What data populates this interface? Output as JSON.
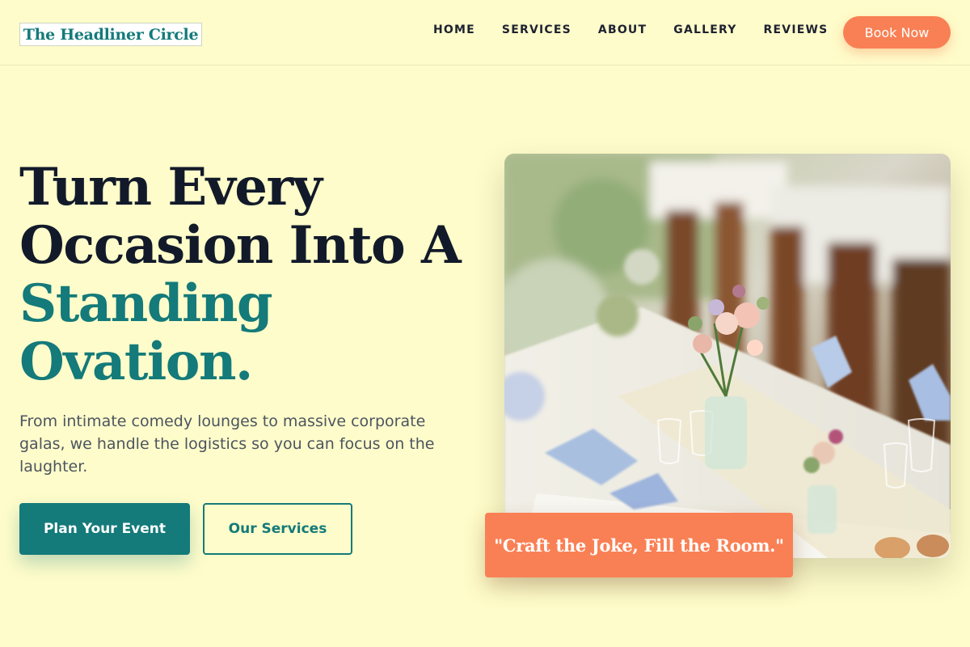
{
  "brand": {
    "name": "The Headliner Circle"
  },
  "nav": {
    "links": [
      "HOME",
      "SERVICES",
      "ABOUT",
      "GALLERY",
      "REVIEWS"
    ],
    "cta": "Book Now"
  },
  "hero": {
    "headline_line1": "Turn Every",
    "headline_line2": "Occasion Into A",
    "headline_accent1": "Standing",
    "headline_accent2": "Ovation.",
    "subtext": "From intimate comedy lounges to massive corporate galas, we handle the logistics so you can focus on the laughter.",
    "primary_button": "Plan Your Event",
    "secondary_button": "Our Services",
    "quote": "\"Craft the Joke, Fill the Room.\""
  },
  "colors": {
    "background": "#fefcca",
    "accent_teal": "#147a7a",
    "accent_coral": "#f98054",
    "headline_dark": "#121a2a"
  }
}
